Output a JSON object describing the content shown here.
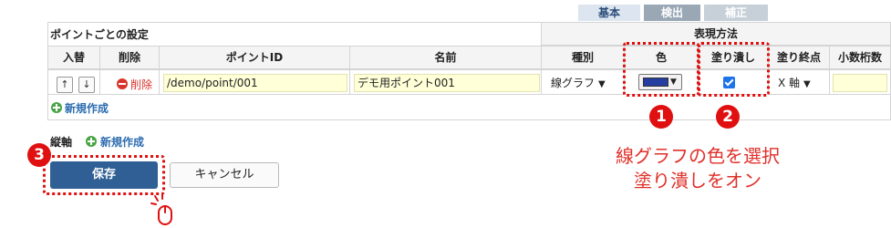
{
  "tabs": [
    {
      "label": "基本",
      "active": true
    },
    {
      "label": "検出",
      "active": false
    },
    {
      "label": "補正",
      "active": false
    }
  ],
  "section_title": "ポイントごとの設定",
  "header_group": "表現方法",
  "columns": {
    "swap": "入替",
    "delete": "削除",
    "point_id": "ポイントID",
    "name": "名前",
    "type": "種別",
    "color": "色",
    "fill": "塗り潰し",
    "fill_end": "塗り終点",
    "decimals": "小数桁数"
  },
  "row": {
    "up_arrow": "↑",
    "down_arrow": "↓",
    "delete_label": "削除",
    "point_id": "/demo/point/001",
    "name": "デモ用ポイント001",
    "type": "線グラフ",
    "color": "#233ea0",
    "fill_checked": true,
    "fill_end": "X 軸",
    "decimals": ""
  },
  "add_new_row": "新規作成",
  "vertical_axis_label": "縦軸",
  "vertical_axis_add": "新規作成",
  "buttons": {
    "save": "保存",
    "cancel": "キャンセル"
  },
  "badges": [
    "1",
    "2",
    "3"
  ],
  "annotation": {
    "line1": "線グラフの色を選択",
    "line2": "塗り潰しをオン"
  },
  "colors": {
    "accent_red": "#e01010",
    "save_button": "#2f5f94",
    "link": "#2b6cb0",
    "add_icon": "#4aa546",
    "delete": "#d9342b"
  }
}
